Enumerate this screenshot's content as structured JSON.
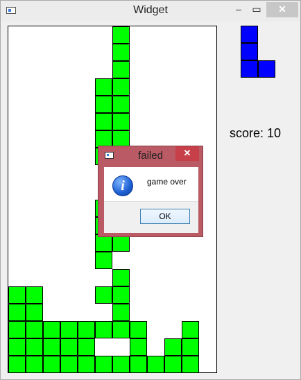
{
  "window": {
    "title": "Widget",
    "minimize_label": "‒",
    "maximize_label": "▭",
    "close_label": "✕"
  },
  "game": {
    "score_text": "score: 10",
    "board": {
      "cols": 12,
      "rows": 20
    },
    "filled_cells": [
      [
        6,
        0
      ],
      [
        6,
        1
      ],
      [
        6,
        2
      ],
      [
        5,
        3
      ],
      [
        6,
        3
      ],
      [
        5,
        4
      ],
      [
        6,
        4
      ],
      [
        5,
        5
      ],
      [
        6,
        5
      ],
      [
        5,
        6
      ],
      [
        6,
        6
      ],
      [
        5,
        7
      ],
      [
        6,
        7
      ],
      [
        5,
        10
      ],
      [
        5,
        11
      ],
      [
        5,
        12
      ],
      [
        6,
        12
      ],
      [
        5,
        13
      ],
      [
        6,
        14
      ],
      [
        5,
        15
      ],
      [
        6,
        15
      ],
      [
        0,
        15
      ],
      [
        1,
        15
      ],
      [
        0,
        16
      ],
      [
        1,
        16
      ],
      [
        6,
        16
      ],
      [
        0,
        17
      ],
      [
        1,
        17
      ],
      [
        2,
        17
      ],
      [
        3,
        17
      ],
      [
        4,
        17
      ],
      [
        5,
        17
      ],
      [
        6,
        17
      ],
      [
        7,
        17
      ],
      [
        10,
        17
      ],
      [
        0,
        18
      ],
      [
        1,
        18
      ],
      [
        2,
        18
      ],
      [
        3,
        18
      ],
      [
        4,
        18
      ],
      [
        7,
        18
      ],
      [
        9,
        18
      ],
      [
        10,
        18
      ],
      [
        0,
        19
      ],
      [
        1,
        19
      ],
      [
        2,
        19
      ],
      [
        3,
        19
      ],
      [
        4,
        19
      ],
      [
        5,
        19
      ],
      [
        6,
        19
      ],
      [
        7,
        19
      ],
      [
        8,
        19
      ],
      [
        9,
        19
      ],
      [
        10,
        19
      ]
    ],
    "block_color": "#00ff00",
    "next_piece": {
      "name": "L",
      "color": "#0000ff",
      "cells": [
        [
          0,
          0
        ],
        [
          0,
          1
        ],
        [
          0,
          2
        ],
        [
          1,
          2
        ]
      ]
    }
  },
  "dialog": {
    "title": "failed",
    "close_label": "✕",
    "icon": "info-icon",
    "message": "game over",
    "ok_label": "OK"
  }
}
